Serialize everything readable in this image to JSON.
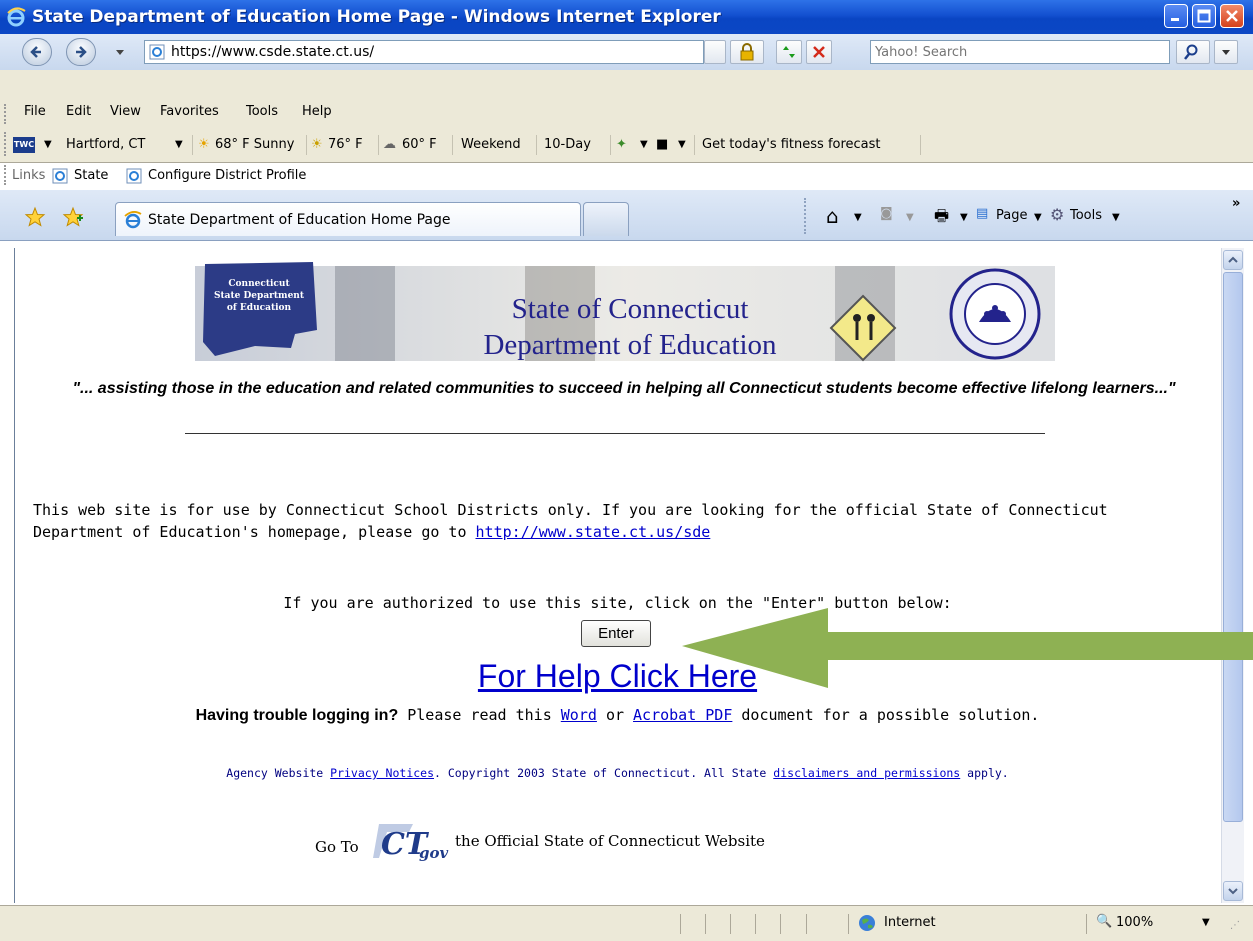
{
  "window": {
    "title": "State Department of Education Home Page - Windows Internet Explorer"
  },
  "address_bar": {
    "url": "https://www.csde.state.ct.us/",
    "search_placeholder": "Yahoo! Search"
  },
  "menu": [
    "File",
    "Edit",
    "View",
    "Favorites",
    "Tools",
    "Help"
  ],
  "weather_toolbar": {
    "logo": "TWC",
    "location": "Hartford, CT",
    "current": "68° F Sunny",
    "high": "76° F",
    "low": "60° F",
    "weekend": "Weekend",
    "ten_day": "10-Day",
    "fitness": "Get today's fitness forecast"
  },
  "links_bar": {
    "label": "Links",
    "items": [
      "State",
      "Configure District Profile"
    ]
  },
  "tab": {
    "title": "State Department of Education Home Page"
  },
  "command_bar": {
    "page": "Page",
    "tools": "Tools"
  },
  "page": {
    "banner_logo_text": "Connecticut State Department of Education",
    "banner_line1": "State of Connecticut",
    "banner_line2": "Department of Education",
    "tagline": "\"... assisting those in the education and related communities to succeed in helping all Connecticut students become effective lifelong learners...\"",
    "notice_text": "This web site is for use by Connecticut School Districts only. If you are looking for the official State of Connecticut Department of Education's homepage, please go to",
    "notice_link": "http://www.state.ct.us/sde",
    "auth_text": "If you are authorized to use this site, click on the \"Enter\" button below:",
    "enter_label": "Enter",
    "help_link": "For Help Click Here",
    "trouble_bold": "Having trouble logging in?",
    "trouble_text1": "Please read this",
    "trouble_word": "Word",
    "trouble_or": "or",
    "trouble_pdf": "Acrobat PDF",
    "trouble_text2": "document for a possible solution.",
    "footer_prefix": "Agency Website",
    "footer_privacy": "Privacy Notices",
    "footer_copyright": ".  Copyright  2003 State of Connecticut.  All State",
    "footer_disclaimers": "disclaimers and permissions",
    "footer_suffix": "apply.",
    "goto_prefix": "Go To",
    "goto_logo": "CT gov",
    "goto_suffix": "the Official State of Connecticut Website"
  },
  "status_bar": {
    "zone": "Internet",
    "zoom": "100%"
  },
  "colors": {
    "titlebar": "#0b47c5",
    "link": "#0000cc",
    "arrow": "#8eb153"
  }
}
